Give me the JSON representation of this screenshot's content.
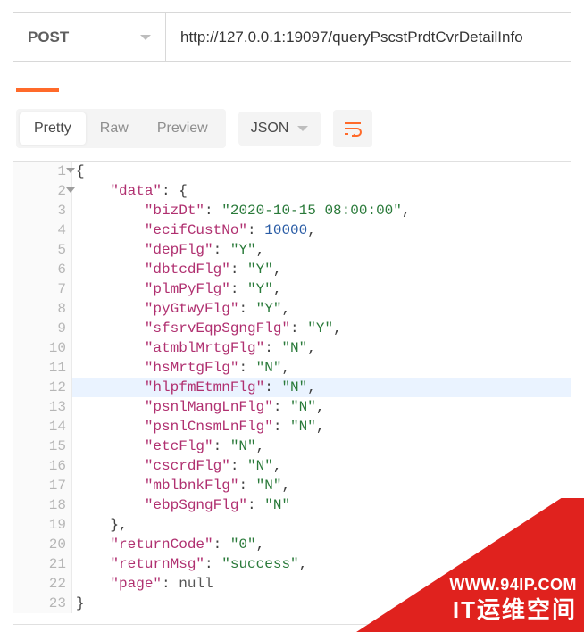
{
  "request": {
    "method": "POST",
    "url": "http://127.0.0.1:19097/queryPscstPrdtCvrDetailInfo"
  },
  "viewTabs": {
    "pretty": "Pretty",
    "raw": "Raw",
    "preview": "Preview",
    "active": "pretty"
  },
  "formatSelect": "JSON",
  "editor": {
    "highlightLine": 12,
    "foldableLines": [
      1,
      2
    ],
    "lines": [
      {
        "n": 1,
        "indent": 0,
        "tokens": [
          {
            "t": "p",
            "v": "{"
          }
        ]
      },
      {
        "n": 2,
        "indent": 1,
        "tokens": [
          {
            "t": "k",
            "v": "\"data\""
          },
          {
            "t": "p",
            "v": ": {"
          }
        ]
      },
      {
        "n": 3,
        "indent": 2,
        "tokens": [
          {
            "t": "k",
            "v": "\"bizDt\""
          },
          {
            "t": "p",
            "v": ": "
          },
          {
            "t": "s",
            "v": "\"2020-10-15 08:00:00\""
          },
          {
            "t": "p",
            "v": ","
          }
        ]
      },
      {
        "n": 4,
        "indent": 2,
        "tokens": [
          {
            "t": "k",
            "v": "\"ecifCustNo\""
          },
          {
            "t": "p",
            "v": ": "
          },
          {
            "t": "n",
            "v": "10000"
          },
          {
            "t": "p",
            "v": ","
          }
        ]
      },
      {
        "n": 5,
        "indent": 2,
        "tokens": [
          {
            "t": "k",
            "v": "\"depFlg\""
          },
          {
            "t": "p",
            "v": ": "
          },
          {
            "t": "s",
            "v": "\"Y\""
          },
          {
            "t": "p",
            "v": ","
          }
        ]
      },
      {
        "n": 6,
        "indent": 2,
        "tokens": [
          {
            "t": "k",
            "v": "\"dbtcdFlg\""
          },
          {
            "t": "p",
            "v": ": "
          },
          {
            "t": "s",
            "v": "\"Y\""
          },
          {
            "t": "p",
            "v": ","
          }
        ]
      },
      {
        "n": 7,
        "indent": 2,
        "tokens": [
          {
            "t": "k",
            "v": "\"plmPyFlg\""
          },
          {
            "t": "p",
            "v": ": "
          },
          {
            "t": "s",
            "v": "\"Y\""
          },
          {
            "t": "p",
            "v": ","
          }
        ]
      },
      {
        "n": 8,
        "indent": 2,
        "tokens": [
          {
            "t": "k",
            "v": "\"pyGtwyFlg\""
          },
          {
            "t": "p",
            "v": ": "
          },
          {
            "t": "s",
            "v": "\"Y\""
          },
          {
            "t": "p",
            "v": ","
          }
        ]
      },
      {
        "n": 9,
        "indent": 2,
        "tokens": [
          {
            "t": "k",
            "v": "\"sfsrvEqpSgngFlg\""
          },
          {
            "t": "p",
            "v": ": "
          },
          {
            "t": "s",
            "v": "\"Y\""
          },
          {
            "t": "p",
            "v": ","
          }
        ]
      },
      {
        "n": 10,
        "indent": 2,
        "tokens": [
          {
            "t": "k",
            "v": "\"atmblMrtgFlg\""
          },
          {
            "t": "p",
            "v": ": "
          },
          {
            "t": "s",
            "v": "\"N\""
          },
          {
            "t": "p",
            "v": ","
          }
        ]
      },
      {
        "n": 11,
        "indent": 2,
        "tokens": [
          {
            "t": "k",
            "v": "\"hsMrtgFlg\""
          },
          {
            "t": "p",
            "v": ": "
          },
          {
            "t": "s",
            "v": "\"N\""
          },
          {
            "t": "p",
            "v": ","
          }
        ]
      },
      {
        "n": 12,
        "indent": 2,
        "tokens": [
          {
            "t": "k",
            "v": "\"hlpfmEtmnFlg\""
          },
          {
            "t": "p",
            "v": ": "
          },
          {
            "t": "s",
            "v": "\"N\""
          },
          {
            "t": "p",
            "v": ","
          }
        ]
      },
      {
        "n": 13,
        "indent": 2,
        "tokens": [
          {
            "t": "k",
            "v": "\"psnlMangLnFlg\""
          },
          {
            "t": "p",
            "v": ": "
          },
          {
            "t": "s",
            "v": "\"N\""
          },
          {
            "t": "p",
            "v": ","
          }
        ]
      },
      {
        "n": 14,
        "indent": 2,
        "tokens": [
          {
            "t": "k",
            "v": "\"psnlCnsmLnFlg\""
          },
          {
            "t": "p",
            "v": ": "
          },
          {
            "t": "s",
            "v": "\"N\""
          },
          {
            "t": "p",
            "v": ","
          }
        ]
      },
      {
        "n": 15,
        "indent": 2,
        "tokens": [
          {
            "t": "k",
            "v": "\"etcFlg\""
          },
          {
            "t": "p",
            "v": ": "
          },
          {
            "t": "s",
            "v": "\"N\""
          },
          {
            "t": "p",
            "v": ","
          }
        ]
      },
      {
        "n": 16,
        "indent": 2,
        "tokens": [
          {
            "t": "k",
            "v": "\"cscrdFlg\""
          },
          {
            "t": "p",
            "v": ": "
          },
          {
            "t": "s",
            "v": "\"N\""
          },
          {
            "t": "p",
            "v": ","
          }
        ]
      },
      {
        "n": 17,
        "indent": 2,
        "tokens": [
          {
            "t": "k",
            "v": "\"mblbnkFlg\""
          },
          {
            "t": "p",
            "v": ": "
          },
          {
            "t": "s",
            "v": "\"N\""
          },
          {
            "t": "p",
            "v": ","
          }
        ]
      },
      {
        "n": 18,
        "indent": 2,
        "tokens": [
          {
            "t": "k",
            "v": "\"ebpSgngFlg\""
          },
          {
            "t": "p",
            "v": ": "
          },
          {
            "t": "s",
            "v": "\"N\""
          }
        ]
      },
      {
        "n": 19,
        "indent": 1,
        "tokens": [
          {
            "t": "p",
            "v": "},"
          }
        ]
      },
      {
        "n": 20,
        "indent": 1,
        "tokens": [
          {
            "t": "k",
            "v": "\"returnCode\""
          },
          {
            "t": "p",
            "v": ": "
          },
          {
            "t": "s",
            "v": "\"0\""
          },
          {
            "t": "p",
            "v": ","
          }
        ]
      },
      {
        "n": 21,
        "indent": 1,
        "tokens": [
          {
            "t": "k",
            "v": "\"returnMsg\""
          },
          {
            "t": "p",
            "v": ": "
          },
          {
            "t": "s",
            "v": "\"success\""
          },
          {
            "t": "p",
            "v": ","
          }
        ]
      },
      {
        "n": 22,
        "indent": 1,
        "tokens": [
          {
            "t": "k",
            "v": "\"page\""
          },
          {
            "t": "p",
            "v": ": "
          },
          {
            "t": "null",
            "v": "null"
          }
        ]
      },
      {
        "n": 23,
        "indent": 0,
        "tokens": [
          {
            "t": "p",
            "v": "}"
          }
        ]
      }
    ]
  },
  "watermark": {
    "site": "WWW.94IP.COM",
    "brand": "IT运维空间"
  }
}
